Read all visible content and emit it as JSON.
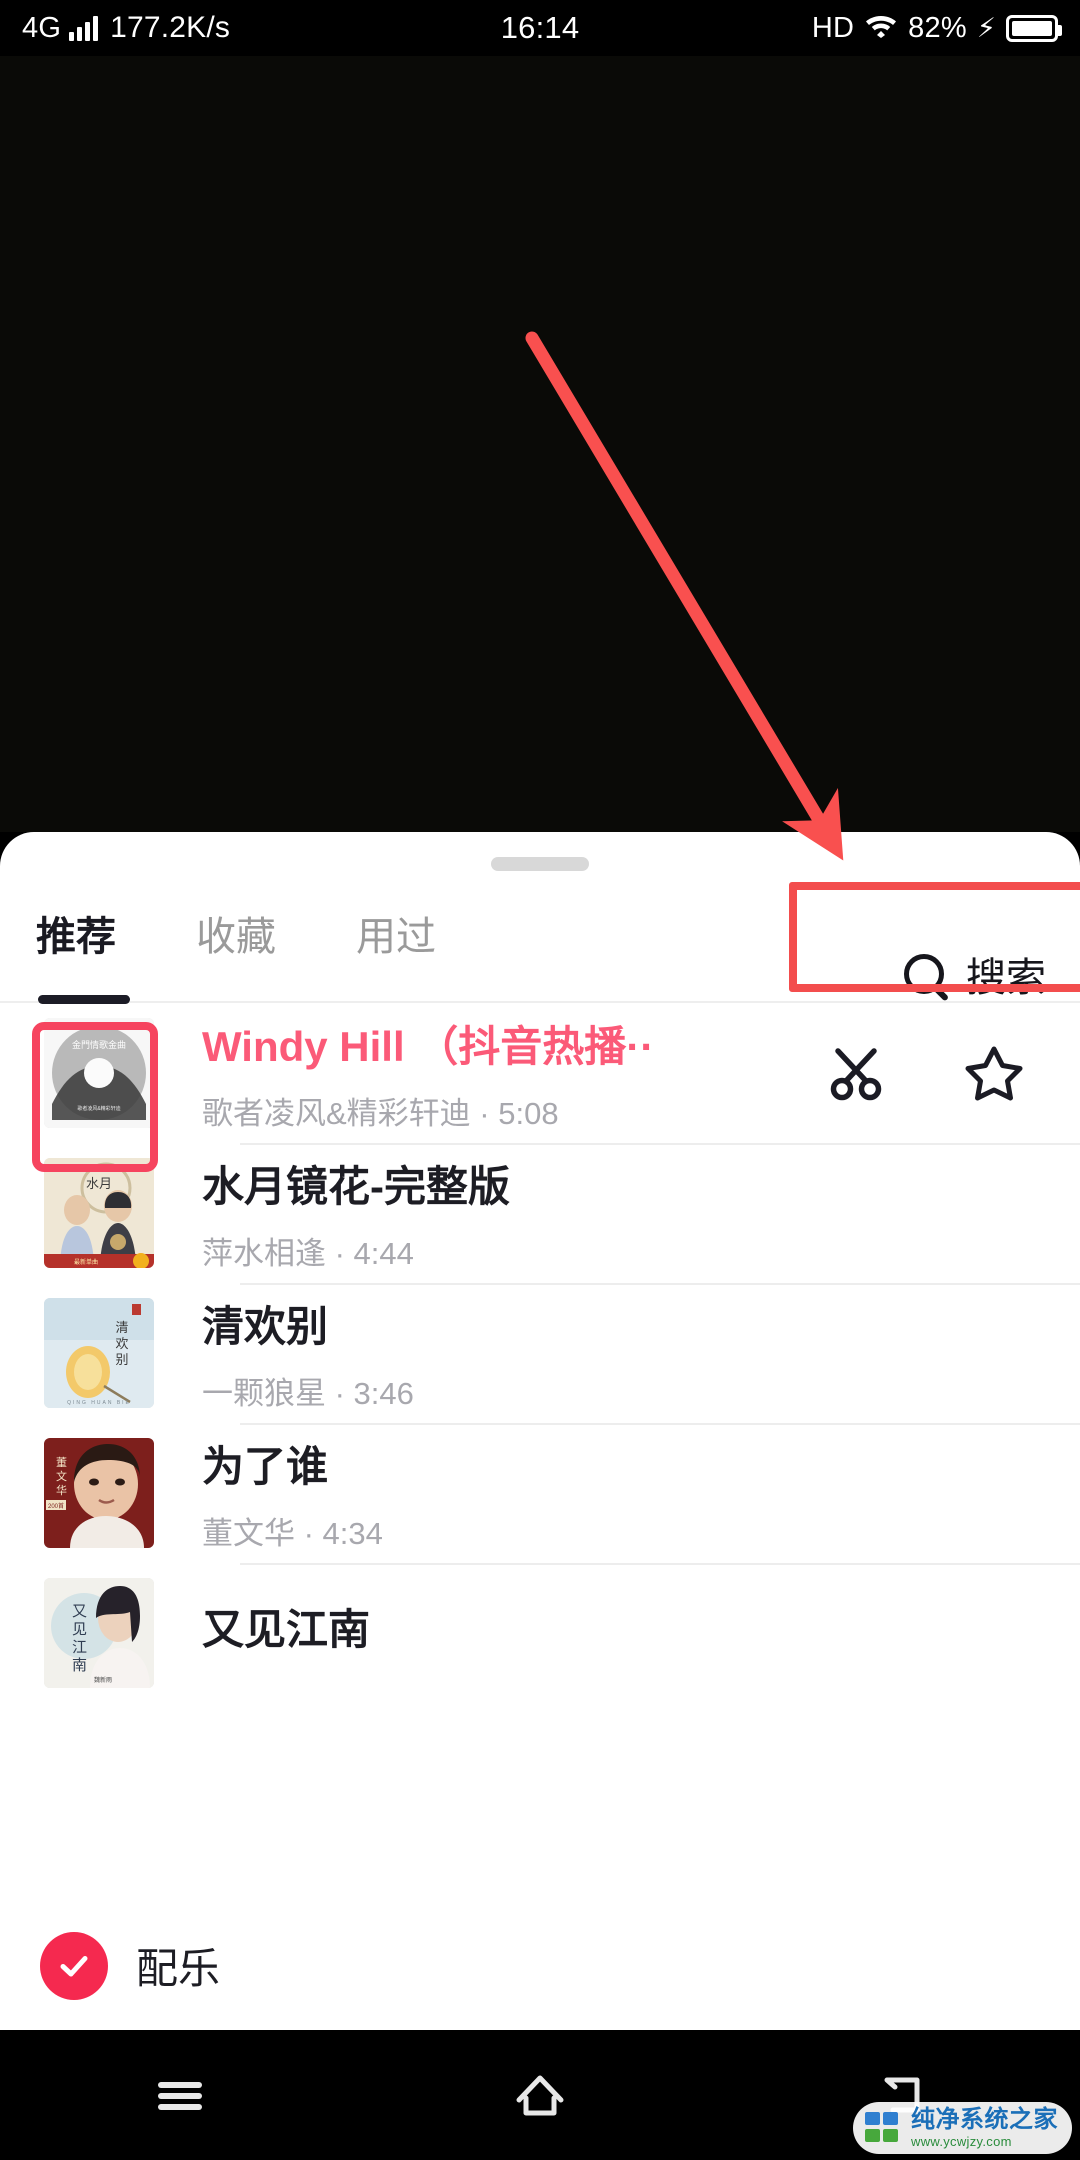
{
  "status_bar": {
    "network_type": "4G",
    "speed": "177.2K/s",
    "time": "16:14",
    "hd": "HD",
    "battery_percent": "82%",
    "charging_glyph": "⚡"
  },
  "sheet": {
    "tabs": [
      {
        "label": "推荐",
        "active": true
      },
      {
        "label": "收藏",
        "active": false
      },
      {
        "label": "用过",
        "active": false
      }
    ],
    "search_label": "搜索"
  },
  "songs": [
    {
      "title": "Windy Hill （抖音热播··",
      "artist": "歌者凌风&精彩轩迪",
      "duration": "5:08",
      "subtitle": "歌者凌风&精彩轩迪 · 5:08",
      "selected": true,
      "cover_kind": "cd-disc"
    },
    {
      "title": "水月镜花-完整版",
      "artist": "萍水相逢",
      "duration": "4:44",
      "subtitle": "萍水相逢 · 4:44",
      "selected": false,
      "cover_kind": "duet-poster"
    },
    {
      "title": "清欢别",
      "artist": "一颗狼星",
      "duration": "3:46",
      "subtitle": "一颗狼星 · 3:46",
      "selected": false,
      "cover_kind": "lantern"
    },
    {
      "title": "为了谁",
      "artist": "董文华",
      "duration": "4:34",
      "subtitle": "董文华 · 4:34",
      "selected": false,
      "cover_kind": "portrait-red"
    },
    {
      "title": "又见江南",
      "artist": "",
      "duration": "",
      "subtitle": "",
      "selected": false,
      "cover_kind": "portrait-blue"
    }
  ],
  "bottom_bar": {
    "bgm_label": "配乐"
  },
  "nav_bar": {
    "menu": "menu-icon",
    "home": "home-icon",
    "back": "back-icon"
  },
  "watermark": {
    "title": "纯净系统之家",
    "url": "www.ycwjzy.com"
  },
  "annotations": {
    "arrow_color": "#f9504f",
    "search_box_color": "#f34d4d",
    "cover_box_color": "#f6445f"
  },
  "colors": {
    "accent_pink": "#fb5a78",
    "check_red": "#f5294f",
    "tab_active": "#1c1c26",
    "tab_inactive": "#9a9a9a",
    "sub_text": "#a8a8ae"
  }
}
